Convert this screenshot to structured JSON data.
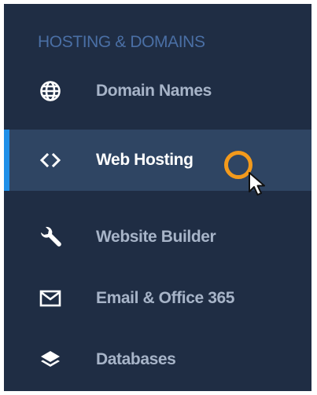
{
  "sidebar": {
    "section_heading": "HOSTING & DOMAINS",
    "items": [
      {
        "label": "Domain Names",
        "icon": "globe-icon",
        "active": false
      },
      {
        "label": "Web Hosting",
        "icon": "code-brackets-icon",
        "active": true
      },
      {
        "label": "Website Builder",
        "icon": "wrench-icon",
        "active": false
      },
      {
        "label": "Email & Office 365",
        "icon": "envelope-icon",
        "active": false
      },
      {
        "label": "Databases",
        "icon": "layers-icon",
        "active": false
      }
    ]
  },
  "colors": {
    "sidebar_bg": "#1f2d44",
    "active_bg": "#2f4563",
    "active_indicator": "#1e8fe8",
    "heading_text": "#4a6fa5",
    "item_text": "#a7b4c8",
    "active_text": "#ffffff",
    "click_ring": "#f39a1c"
  }
}
